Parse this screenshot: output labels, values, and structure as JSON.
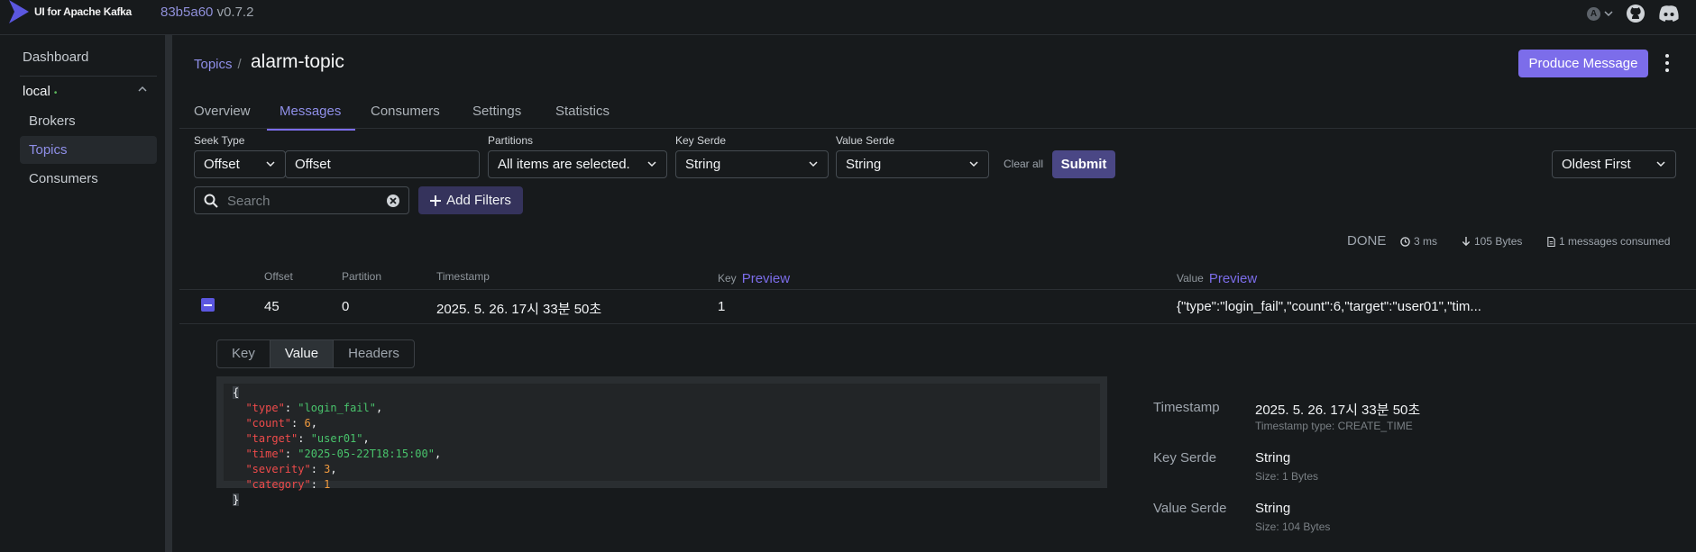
{
  "header": {
    "app_title": "UI for Apache Kafka",
    "commit": "83b5a60",
    "version": "v0.7.2",
    "user_initial": "A"
  },
  "sidebar": {
    "dashboard": "Dashboard",
    "cluster": "local",
    "cluster_status_dot": "•",
    "items": [
      {
        "label": "Brokers"
      },
      {
        "label": "Topics"
      },
      {
        "label": "Consumers"
      }
    ]
  },
  "page": {
    "breadcrumb_root": "Topics",
    "breadcrumb_sep": "/",
    "title": "alarm-topic",
    "produce_button": "Produce Message"
  },
  "tabs": [
    "Overview",
    "Messages",
    "Consumers",
    "Settings",
    "Statistics"
  ],
  "filters": {
    "seek_type_label": "Seek Type",
    "seek_type_value": "Offset",
    "offset_value": "Offset",
    "partitions_label": "Partitions",
    "partitions_value": "All items are selected.",
    "key_serde_label": "Key Serde",
    "key_serde_value": "String",
    "value_serde_label": "Value Serde",
    "value_serde_value": "String",
    "clear_all": "Clear all",
    "submit": "Submit",
    "sort_value": "Oldest First",
    "search_placeholder": "Search",
    "add_filters": "Add Filters"
  },
  "status": {
    "state": "DONE",
    "elapsed": "3 ms",
    "bytes": "105 Bytes",
    "consumed": "1 messages consumed"
  },
  "table": {
    "headers": {
      "offset": "Offset",
      "partition": "Partition",
      "timestamp": "Timestamp",
      "key": "Key",
      "value": "Value",
      "preview": "Preview"
    },
    "rows": [
      {
        "offset": "45",
        "partition": "0",
        "timestamp": "2025. 5. 26. 17시 33분 50초",
        "key": "1",
        "value": "{\"type\":\"login_fail\",\"count\":6,\"target\":\"user01\",\"tim..."
      }
    ]
  },
  "details": {
    "tabs": [
      "Key",
      "Value",
      "Headers"
    ],
    "active_tab": "Value",
    "json": {
      "open": "{",
      "close": "}",
      "lines": [
        {
          "key": "\"type\"",
          "value": "\"login_fail\"",
          "kind": "s",
          "comma": ","
        },
        {
          "key": "\"count\"",
          "value": "6",
          "kind": "n",
          "comma": ","
        },
        {
          "key": "\"target\"",
          "value": "\"user01\"",
          "kind": "s",
          "comma": ","
        },
        {
          "key": "\"time\"",
          "value": "\"2025-05-22T18:15:00\"",
          "kind": "s",
          "comma": ","
        },
        {
          "key": "\"severity\"",
          "value": "3",
          "kind": "n",
          "comma": ","
        },
        {
          "key": "\"category\"",
          "value": "1",
          "kind": "n",
          "comma": ""
        }
      ]
    },
    "meta": {
      "timestamp_label": "Timestamp",
      "timestamp_value": "2025. 5. 26. 17시 33분 50초",
      "timestamp_type": "Timestamp type: CREATE_TIME",
      "key_serde_label": "Key Serde",
      "key_serde_value": "String",
      "key_size": "Size: 1 Bytes",
      "value_serde_label": "Value Serde",
      "value_serde_value": "String",
      "value_size": "Size: 104 Bytes"
    }
  },
  "colors": {
    "accent": "#7c6dea",
    "background": "#171a1c",
    "json_key": "#ef4b4b",
    "json_string": "#49c46c",
    "json_number": "#f09a3e"
  }
}
